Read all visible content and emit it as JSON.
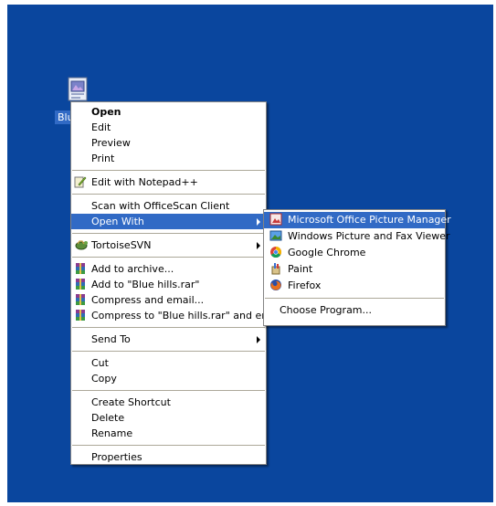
{
  "desktop": {
    "icon_label": "Blue",
    "icon_name": "image-file-icon"
  },
  "context_menu": {
    "items": [
      {
        "label": "Open",
        "bold": true
      },
      {
        "label": "Edit"
      },
      {
        "label": "Preview"
      },
      {
        "label": "Print"
      },
      {
        "label": "Edit with Notepad++",
        "icon": "notepad-plus-plus-icon"
      },
      {
        "label": "Scan with OfficeScan Client"
      },
      {
        "label": "Open With",
        "selected": true,
        "submenu": true
      },
      {
        "label": "TortoiseSVN",
        "icon": "tortoisesvn-icon",
        "submenu": true
      },
      {
        "label": "Add to archive...",
        "icon": "winrar-icon"
      },
      {
        "label": "Add to \"Blue hills.rar\"",
        "icon": "winrar-icon"
      },
      {
        "label": "Compress and email...",
        "icon": "winrar-icon"
      },
      {
        "label": "Compress to \"Blue hills.rar\" and email",
        "icon": "winrar-icon"
      },
      {
        "label": "Send To",
        "submenu": true
      },
      {
        "label": "Cut"
      },
      {
        "label": "Copy"
      },
      {
        "label": "Create Shortcut"
      },
      {
        "label": "Delete"
      },
      {
        "label": "Rename"
      },
      {
        "label": "Properties"
      }
    ]
  },
  "open_with_menu": {
    "items": [
      {
        "label": "Microsoft Office Picture Manager",
        "icon": "picture-manager-icon",
        "selected": true
      },
      {
        "label": "Windows Picture and Fax Viewer",
        "icon": "picture-fax-viewer-icon"
      },
      {
        "label": "Google Chrome",
        "icon": "chrome-icon"
      },
      {
        "label": "Paint",
        "icon": "paint-icon"
      },
      {
        "label": "Firefox",
        "icon": "firefox-icon"
      },
      {
        "label": "Choose Program..."
      }
    ]
  },
  "colors": {
    "desktop": "#0a469e",
    "highlight": "#316ac5",
    "menu_border": "#848484",
    "separator": "#aca899"
  }
}
